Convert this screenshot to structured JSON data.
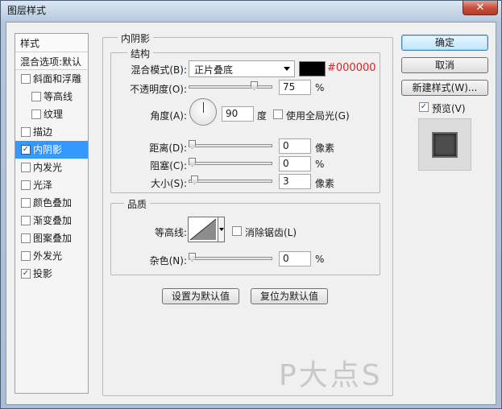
{
  "window": {
    "title": "图层样式",
    "close_glyph": "✕"
  },
  "style_list": {
    "header": "样式",
    "blend_options": "混合选项:默认",
    "items": [
      {
        "label": "斜面和浮雕",
        "checked": false
      },
      {
        "label": "等高线",
        "checked": false
      },
      {
        "label": "纹理",
        "checked": false
      },
      {
        "label": "描边",
        "checked": false
      },
      {
        "label": "内阴影",
        "checked": true
      },
      {
        "label": "内发光",
        "checked": false
      },
      {
        "label": "光泽",
        "checked": false
      },
      {
        "label": "颜色叠加",
        "checked": false
      },
      {
        "label": "渐变叠加",
        "checked": false
      },
      {
        "label": "图案叠加",
        "checked": false
      },
      {
        "label": "外发光",
        "checked": false
      },
      {
        "label": "投影",
        "checked": true
      }
    ],
    "check_glyph": "✓"
  },
  "inner_shadow": {
    "title": "内阴影",
    "structure": {
      "title": "结构",
      "blend_mode_label": "混合模式(B):",
      "blend_mode_value": "正片叠底",
      "color_hex": "#000000",
      "opacity_label": "不透明度(O):",
      "opacity_value": "75",
      "opacity_unit": "%",
      "angle_label": "角度(A):",
      "angle_value": "90",
      "angle_unit": "度",
      "global_light_label": "使用全局光(G)",
      "global_light_checked": false,
      "distance_label": "距离(D):",
      "distance_value": "0",
      "distance_unit": "像素",
      "choke_label": "阻塞(C):",
      "choke_value": "0",
      "choke_unit": "%",
      "size_label": "大小(S):",
      "size_value": "3",
      "size_unit": "像素"
    },
    "quality": {
      "title": "品质",
      "contour_label": "等高线:",
      "antialias_label": "消除锯齿(L)",
      "antialias_checked": false,
      "noise_label": "杂色(N):",
      "noise_value": "0",
      "noise_unit": "%"
    },
    "set_default": "设置为默认值",
    "reset_default": "复位为默认值"
  },
  "buttons": {
    "ok": "确定",
    "cancel": "取消",
    "new_style": "新建样式(W)...",
    "preview_label": "预览(V)",
    "preview_checked": true
  },
  "watermark": "P大点S",
  "colors": {
    "selected_bg": "#3399ff",
    "hex_text": "#e0201c",
    "swatch": "#000000"
  },
  "slider_levels": {
    "opacity": 0.75,
    "distance": 0,
    "choke": 0,
    "size": 0.03,
    "noise": 0
  }
}
